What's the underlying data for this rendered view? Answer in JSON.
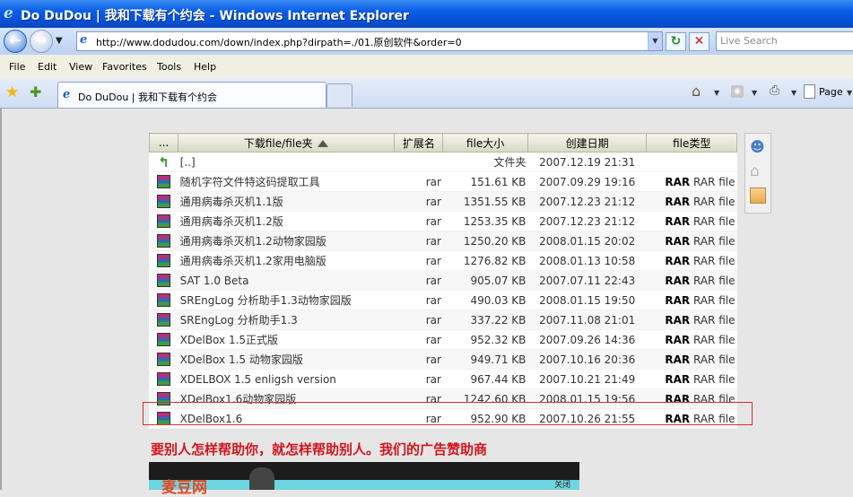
{
  "window": {
    "title": "Do DuDou | 我和下载有个约会 - Windows Internet Explorer"
  },
  "address": {
    "url": "http://www.dodudou.com/down/index.php?dirpath=./01.原创软件&order=0"
  },
  "search": {
    "placeholder": "Live Search"
  },
  "menu": [
    "File",
    "Edit",
    "View",
    "Favorites",
    "Tools",
    "Help"
  ],
  "tab": {
    "label": "Do DuDou | 我和下载有个约会"
  },
  "toolbar": {
    "page_label": "Page"
  },
  "table": {
    "headers": [
      "...",
      "下载file/file夹",
      "扩展名",
      "file大小",
      "创建日期",
      "file类型"
    ],
    "up_row": {
      "name": "[..]",
      "size": "文件夹",
      "date": "2007.12.19 21:31"
    },
    "rows": [
      {
        "name": "随机字符文件特这码提取工具",
        "ext": "rar",
        "size": "151.61 KB",
        "date": "2007.09.29 19:16",
        "type_bold": "RAR",
        "type": "RAR file"
      },
      {
        "name": "通用病毒杀灭机1.1版",
        "ext": "rar",
        "size": "1351.55 KB",
        "date": "2007.12.23 21:12",
        "type_bold": "RAR",
        "type": "RAR file"
      },
      {
        "name": "通用病毒杀灭机1.2版",
        "ext": "rar",
        "size": "1253.35 KB",
        "date": "2007.12.23 21:12",
        "type_bold": "RAR",
        "type": "RAR file"
      },
      {
        "name": "通用病毒杀灭机1.2动物家园版",
        "ext": "rar",
        "size": "1250.20 KB",
        "date": "2008.01.15 20:02",
        "type_bold": "RAR",
        "type": "RAR file"
      },
      {
        "name": "通用病毒杀灭机1.2家用电脑版",
        "ext": "rar",
        "size": "1276.82 KB",
        "date": "2008.01.13 10:58",
        "type_bold": "RAR",
        "type": "RAR file"
      },
      {
        "name": "SAT 1.0 Beta",
        "ext": "rar",
        "size": "905.07 KB",
        "date": "2007.07.11 22:43",
        "type_bold": "RAR",
        "type": "RAR file"
      },
      {
        "name": "SREngLog 分析助手1.3动物家园版",
        "ext": "rar",
        "size": "490.03 KB",
        "date": "2008.01.15 19:50",
        "type_bold": "RAR",
        "type": "RAR file"
      },
      {
        "name": "SREngLog 分析助手1.3",
        "ext": "rar",
        "size": "337.22 KB",
        "date": "2007.11.08 21:01",
        "type_bold": "RAR",
        "type": "RAR file"
      },
      {
        "name": "XDelBox 1.5正式版",
        "ext": "rar",
        "size": "952.32 KB",
        "date": "2007.09.26 14:36",
        "type_bold": "RAR",
        "type": "RAR file"
      },
      {
        "name": "XDelBox 1.5 动物家园版",
        "ext": "rar",
        "size": "949.71 KB",
        "date": "2007.10.16 20:36",
        "type_bold": "RAR",
        "type": "RAR file"
      },
      {
        "name": "XDELBOX 1.5 enligsh version",
        "ext": "rar",
        "size": "967.44 KB",
        "date": "2007.10.21 21:49",
        "type_bold": "RAR",
        "type": "RAR file"
      },
      {
        "name": "XDelBox1.6动物家园版",
        "ext": "rar",
        "size": "1242.60 KB",
        "date": "2008.01.15 19:56",
        "type_bold": "RAR",
        "type": "RAR file"
      },
      {
        "name": "XDelBox1.6",
        "ext": "rar",
        "size": "952.90 KB",
        "date": "2007.10.26 21:55",
        "type_bold": "RAR",
        "type": "RAR file"
      }
    ]
  },
  "ad": {
    "heading": "要别人怎样帮助你，就怎样帮助别人。我们的广告赞助商",
    "banner_text": "麦豆网",
    "close": "关闭"
  }
}
